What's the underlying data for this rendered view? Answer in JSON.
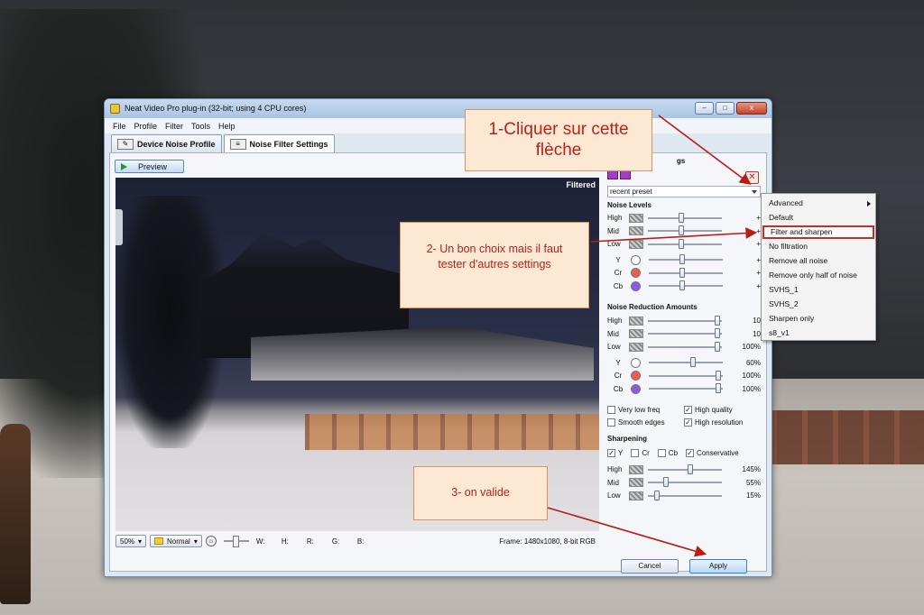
{
  "window": {
    "title": "Neat Video Pro plug-in (32-bit; using 4 CPU cores)",
    "controls": {
      "minimize": "–",
      "maximize": "□",
      "close": "x"
    }
  },
  "menubar": [
    "File",
    "Profile",
    "Filter",
    "Tools",
    "Help"
  ],
  "tabs": [
    {
      "label": "Device Noise Profile"
    },
    {
      "label": "Noise Filter Settings"
    }
  ],
  "preview": {
    "button_label": "Preview",
    "overlay_label": "Filtered"
  },
  "statusbar": {
    "zoom": "50%",
    "mode": "Normal",
    "sun_icon": "☼",
    "labels": {
      "w": "W:",
      "h": "H:",
      "r": "R:",
      "g": "G:",
      "b": "B:"
    },
    "frame": "Frame: 1480x1080, 8-bit RGB"
  },
  "panel": {
    "header": "gs",
    "close_glyph": "✕",
    "preset_value": "recent preset",
    "noise_levels": {
      "title": "Noise Levels",
      "rows": [
        {
          "label": "High",
          "value": "+",
          "pos": 0.45
        },
        {
          "label": "Mid",
          "value": "+",
          "pos": 0.45
        },
        {
          "label": "Low",
          "value": "+",
          "pos": 0.45
        },
        {
          "label": "Y",
          "value": "+",
          "pos": 0.45,
          "color": "#ffffff"
        },
        {
          "label": "Cr",
          "value": "+",
          "pos": 0.45,
          "color": "#f05a50"
        },
        {
          "label": "Cb",
          "value": "+",
          "pos": 0.45,
          "color": "#8a5ae8"
        }
      ]
    },
    "noise_reduction": {
      "title": "Noise Reduction Amounts",
      "rows": [
        {
          "label": "High",
          "value": "10",
          "pos": 0.98
        },
        {
          "label": "Mid",
          "value": "10",
          "pos": 0.98
        },
        {
          "label": "Low",
          "value": "100%",
          "pos": 0.98
        },
        {
          "label": "Y",
          "value": "60%",
          "pos": 0.6,
          "color": "#ffffff"
        },
        {
          "label": "Cr",
          "value": "100%",
          "pos": 0.98,
          "color": "#f05a50"
        },
        {
          "label": "Cb",
          "value": "100%",
          "pos": 0.98,
          "color": "#8a5ae8"
        }
      ]
    },
    "options": [
      {
        "label": "Very low freq",
        "checked": false
      },
      {
        "label": "High quality",
        "checked": true
      },
      {
        "label": "Smooth edges",
        "checked": false
      },
      {
        "label": "High resolution",
        "checked": true
      }
    ],
    "sharpening": {
      "title": "Sharpening",
      "channels": [
        {
          "label": "Y",
          "checked": true
        },
        {
          "label": "Cr",
          "checked": false
        },
        {
          "label": "Cb",
          "checked": false
        },
        {
          "label": "Conservative",
          "checked": true
        }
      ],
      "rows": [
        {
          "label": "High",
          "value": "145%",
          "pos": 0.58
        },
        {
          "label": "Mid",
          "value": "55%",
          "pos": 0.22
        },
        {
          "label": "Low",
          "value": "15%",
          "pos": 0.09
        }
      ]
    }
  },
  "buttons": {
    "cancel": "Cancel",
    "apply": "Apply"
  },
  "preset_menu": {
    "items": [
      "Advanced",
      "Default",
      "Filter and sharpen",
      "No filtration",
      "Remove all noise",
      "Remove only half of noise",
      "SVHS_1",
      "SVHS_2",
      "Sharpen only",
      "s8_v1"
    ],
    "highlighted": 2
  },
  "callouts": {
    "one": "1-Cliquer sur cette flèche",
    "two": "2- Un bon choix mais il faut tester d'autres settings",
    "three": "3- on valide"
  },
  "colors": {
    "callout_text": "#b3241a",
    "callout_bg": "#fde8d3",
    "arrow": "#b81d14"
  }
}
